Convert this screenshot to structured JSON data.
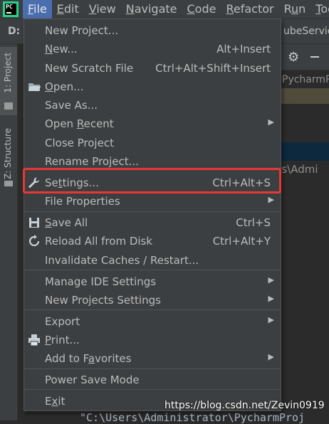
{
  "menubar": {
    "items": [
      {
        "pre": "",
        "u": "F",
        "post": "ile"
      },
      {
        "pre": "",
        "u": "E",
        "post": "dit"
      },
      {
        "pre": "",
        "u": "V",
        "post": "iew"
      },
      {
        "pre": "",
        "u": "N",
        "post": "avigate"
      },
      {
        "pre": "",
        "u": "C",
        "post": "ode"
      },
      {
        "pre": "",
        "u": "R",
        "post": "efactor"
      },
      {
        "pre": "R",
        "u": "u",
        "post": "n"
      },
      {
        "pre": "",
        "u": "T",
        "post": "ool"
      }
    ]
  },
  "background": {
    "drive": "D:",
    "path_tail": "ubeServic",
    "project_name_tail": "PycharmP",
    "path_tail_2": "ers\\Admi",
    "editor_bottom": "\"C:\\Users\\Administrator\\PycharmProj",
    "watermark": "https://blog.csdn.net/Zevin0919"
  },
  "side_tabs": {
    "project": "1: Project",
    "structure": "Z: Structure"
  },
  "file_menu": {
    "items": [
      {
        "pre": "New Project...",
        "u": "",
        "post": "",
        "shortcut": ""
      },
      {
        "pre": "",
        "u": "N",
        "post": "ew...",
        "shortcut": "Alt+Insert"
      },
      {
        "pre": "New Scratch File",
        "u": "",
        "post": "",
        "shortcut": "Ctrl+Alt+Shift+Insert"
      },
      {
        "pre": "",
        "u": "O",
        "post": "pen...",
        "shortcut": ""
      },
      {
        "pre": "Save As...",
        "u": "",
        "post": "",
        "shortcut": ""
      },
      {
        "pre": "Open ",
        "u": "R",
        "post": "ecent",
        "shortcut": ""
      },
      {
        "pre": "Close Project",
        "u": "",
        "post": "",
        "shortcut": ""
      },
      {
        "pre": "Rename Project...",
        "u": "",
        "post": "",
        "shortcut": ""
      },
      {
        "pre": "Se",
        "u": "t",
        "post": "tings...",
        "shortcut": "Ctrl+Alt+S"
      },
      {
        "pre": "File Properties",
        "u": "",
        "post": "",
        "shortcut": ""
      },
      {
        "pre": "",
        "u": "S",
        "post": "ave All",
        "shortcut": "Ctrl+S"
      },
      {
        "pre": "Reload All from Disk",
        "u": "",
        "post": "",
        "shortcut": "Ctrl+Alt+Y"
      },
      {
        "pre": "Invalidate Caches / Restart...",
        "u": "",
        "post": "",
        "shortcut": ""
      },
      {
        "pre": "Manage IDE Settings",
        "u": "",
        "post": "",
        "shortcut": ""
      },
      {
        "pre": "New Projects Settings",
        "u": "",
        "post": "",
        "shortcut": ""
      },
      {
        "pre": "Export",
        "u": "",
        "post": "",
        "shortcut": ""
      },
      {
        "pre": "",
        "u": "P",
        "post": "rint...",
        "shortcut": ""
      },
      {
        "pre": "Add to F",
        "u": "a",
        "post": "vorites",
        "shortcut": ""
      },
      {
        "pre": "Power Save Mode",
        "u": "",
        "post": "",
        "shortcut": ""
      },
      {
        "pre": "E",
        "u": "x",
        "post": "it",
        "shortcut": ""
      }
    ]
  },
  "icons": {
    "open": "folder-icon",
    "settings": "wrench-icon",
    "save_all": "save-icon",
    "reload": "reload-icon",
    "print": "printer-icon",
    "gear": "gear-icon"
  },
  "colors": {
    "menu_bg": "#3c3f41",
    "active_menu": "#4b6eaf",
    "highlight_box": "#e53935",
    "logo_green": "#21d789"
  }
}
